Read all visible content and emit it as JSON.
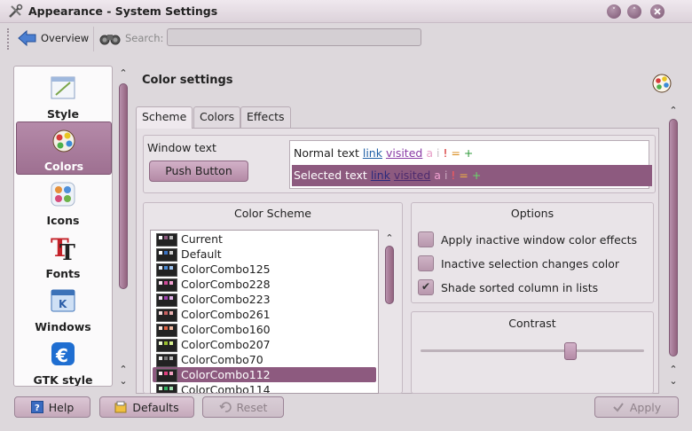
{
  "window": {
    "title": "Appearance - System Settings",
    "minimize_glyph": "˅",
    "maximize_glyph": "˄"
  },
  "toolbar": {
    "overview_label": "Overview",
    "search_label": "Search:",
    "search_value": ""
  },
  "sidebar": {
    "items": [
      {
        "label": "Style",
        "icon": "style-icon"
      },
      {
        "label": "Colors",
        "icon": "colors-icon",
        "selected": true
      },
      {
        "label": "Icons",
        "icon": "icons-icon"
      },
      {
        "label": "Fonts",
        "icon": "fonts-icon"
      },
      {
        "label": "Windows",
        "icon": "windows-icon"
      },
      {
        "label": "GTK style",
        "icon": "gtk-style-icon"
      }
    ]
  },
  "main": {
    "title": "Color settings",
    "tabs": [
      {
        "label": "Scheme",
        "active": true
      },
      {
        "label": "Colors"
      },
      {
        "label": "Effects"
      }
    ],
    "preview": {
      "window_text": "Window text",
      "push_button": "Push Button",
      "normal_text": "Normal text",
      "selected_text": "Selected text",
      "link": "link",
      "visited": "visited",
      "a": "a",
      "i": "i",
      "bang": "!",
      "eq": "=",
      "plus": "+"
    },
    "color_scheme": {
      "title": "Color Scheme",
      "items": [
        "Current",
        "Default",
        "ColorCombo125",
        "ColorCombo228",
        "ColorCombo223",
        "ColorCombo261",
        "ColorCombo160",
        "ColorCombo207",
        "ColorCombo70",
        "ColorCombo112",
        "ColorCombo114"
      ],
      "selected": "ColorCombo112"
    },
    "options": {
      "title": "Options",
      "items": [
        {
          "label": "Apply inactive window color effects",
          "checked": false
        },
        {
          "label": "Inactive selection changes color",
          "checked": false
        },
        {
          "label": "Shade sorted column in lists",
          "checked": true
        }
      ]
    },
    "contrast": {
      "title": "Contrast",
      "value_fraction": 0.68
    }
  },
  "buttons": {
    "help": "Help",
    "defaults": "Defaults",
    "reset": "Reset",
    "apply": "Apply"
  },
  "colors": {
    "accent": "#8d5a7f",
    "link": "#1f5fa6",
    "visited": "#8a3ba5",
    "background": "#ddd8dc"
  }
}
